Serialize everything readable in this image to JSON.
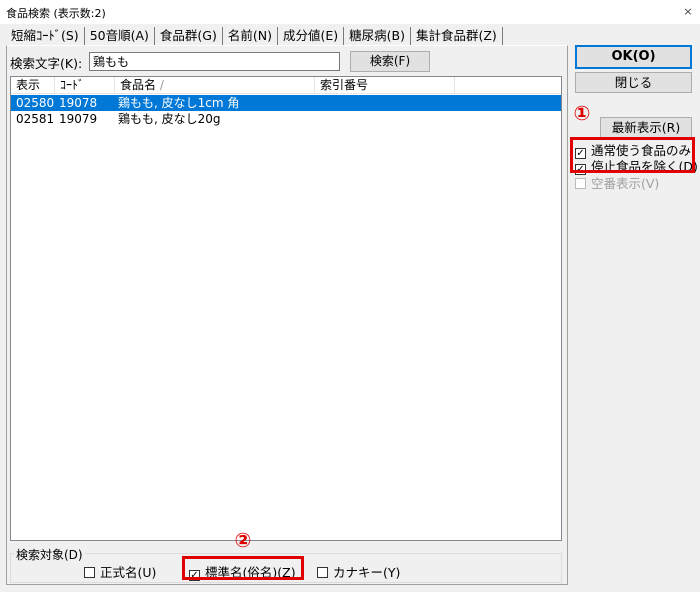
{
  "window": {
    "title": "食品検索 (表示数:2)",
    "close": "×"
  },
  "tabs": [
    "短縮ｺｰﾄﾞ(S)",
    "50音順(A)",
    "食品群(G)",
    "名前(N)",
    "成分値(E)",
    "糖尿病(B)",
    "集計食品群(Z)"
  ],
  "search": {
    "label": "検索文字(K):",
    "value": "鶏もも",
    "button": "検索(F)"
  },
  "list": {
    "columns": [
      "表示",
      "ｺｰﾄﾞ",
      "食品名",
      "索引番号"
    ],
    "sort_mark": "/",
    "rows": [
      {
        "display": "02580",
        "code": "19078",
        "name": "鶏もも, 皮なし1cm 角",
        "index": ""
      },
      {
        "display": "02581",
        "code": "19079",
        "name": "鶏もも, 皮なし20g",
        "index": ""
      }
    ]
  },
  "search_target": {
    "label": "検索対象(D)",
    "options": [
      {
        "label": "正式名(U)",
        "checked": false
      },
      {
        "label": "標準名(俗名)(Z)",
        "checked": true
      },
      {
        "label": "カナキー(Y)",
        "checked": false
      }
    ]
  },
  "right_panel": {
    "ok": "OK(O)",
    "close": "閉じる",
    "recent": "最新表示(R)",
    "checkboxes": [
      {
        "label": "通常使う食品のみ",
        "checked": true,
        "enabled": true
      },
      {
        "label": "停止食品を除く(D)",
        "checked": true,
        "enabled": true
      },
      {
        "label": "空番表示(V)",
        "checked": false,
        "enabled": false
      }
    ]
  },
  "annotations": {
    "marker1": "①",
    "marker2": "②",
    "color": "#e00000"
  },
  "colors": {
    "selection": "#0078d7",
    "background": "#f0f0f0"
  }
}
